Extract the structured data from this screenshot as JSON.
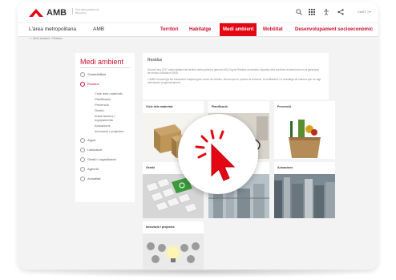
{
  "header": {
    "brand": "AMB",
    "brand_sub": "Àrea Metropolitana de Barcelona",
    "lang": "CAST. | ▾"
  },
  "nav": {
    "site": "L'àrea metropolitana",
    "site_short": "AMB",
    "items": [
      "Territori",
      "Habitatge",
      "Medi ambient",
      "Mobilitat",
      "Desenvolupament socioeconòmic"
    ],
    "active": "Medi ambient"
  },
  "breadcrumb": "⌂  ›  Medi ambient  ›  Residus",
  "sidebar": {
    "title": "Medi ambient",
    "items": [
      {
        "label": "Sostenibilitat"
      },
      {
        "label": "Residus"
      },
      {
        "label": "Aigua"
      },
      {
        "label": "Laboratori"
      },
      {
        "label": "Gestió i organització"
      },
      {
        "label": "Agenda"
      },
      {
        "label": "Actualitat"
      }
    ],
    "sub_items": [
      "Cicle dels materials",
      "Planificació",
      "Prevenció",
      "Gestió",
      "Instal·lacions i equipaments",
      "Actuacions",
      "Innovació i projectes"
    ]
  },
  "content": {
    "title": "Residus",
    "paragraph1": "Durant l'any 2017 cada habitant del territori metropolità ha generat 445,2 kg de Residus domèstics. Aquesta xifra confirma la disminució en la generació de residus iniciada el 2008.",
    "paragraph2": "L'AMB s'encarrega del tractament d'aquest gran volum de residus, alhora que en promou la reducció, la reutilització i el reciclatge de manera que es vagi minimitzant progressivament."
  },
  "tiles": [
    {
      "label": "Cicle dels materials"
    },
    {
      "label": "Planificació"
    },
    {
      "label": "Prevenció"
    },
    {
      "label": "Gestió"
    },
    {
      "label": "Instal·lacions i equipaments"
    },
    {
      "label": "Actuacions"
    },
    {
      "label": "Innovació i projectes"
    }
  ],
  "colors": {
    "accent": "#e30613",
    "brand_red": "#c8102e"
  }
}
